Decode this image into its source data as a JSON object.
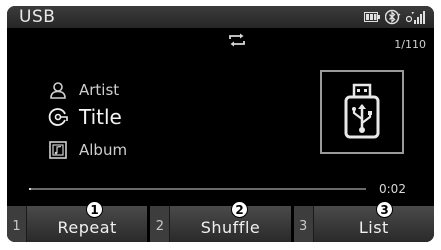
{
  "header": {
    "title": "USB"
  },
  "status_icons": [
    "battery-icon",
    "bluetooth-icon",
    "signal-icon"
  ],
  "playback": {
    "repeat_icon": "repeat-icon",
    "track_count": "1/110",
    "elapsed": "0:02"
  },
  "track": {
    "artist": "Artist",
    "title": "Title",
    "album": "Album"
  },
  "softkeys": [
    {
      "number": "1",
      "label": "Repeat",
      "callout": "1"
    },
    {
      "number": "2",
      "label": "Shuffle",
      "callout": "2"
    },
    {
      "number": "3",
      "label": "List",
      "callout": "3"
    }
  ],
  "colors": {
    "screen_bg": "#000000",
    "text": "#cfcfcf",
    "softkey_bg": "#3a3a3a"
  }
}
